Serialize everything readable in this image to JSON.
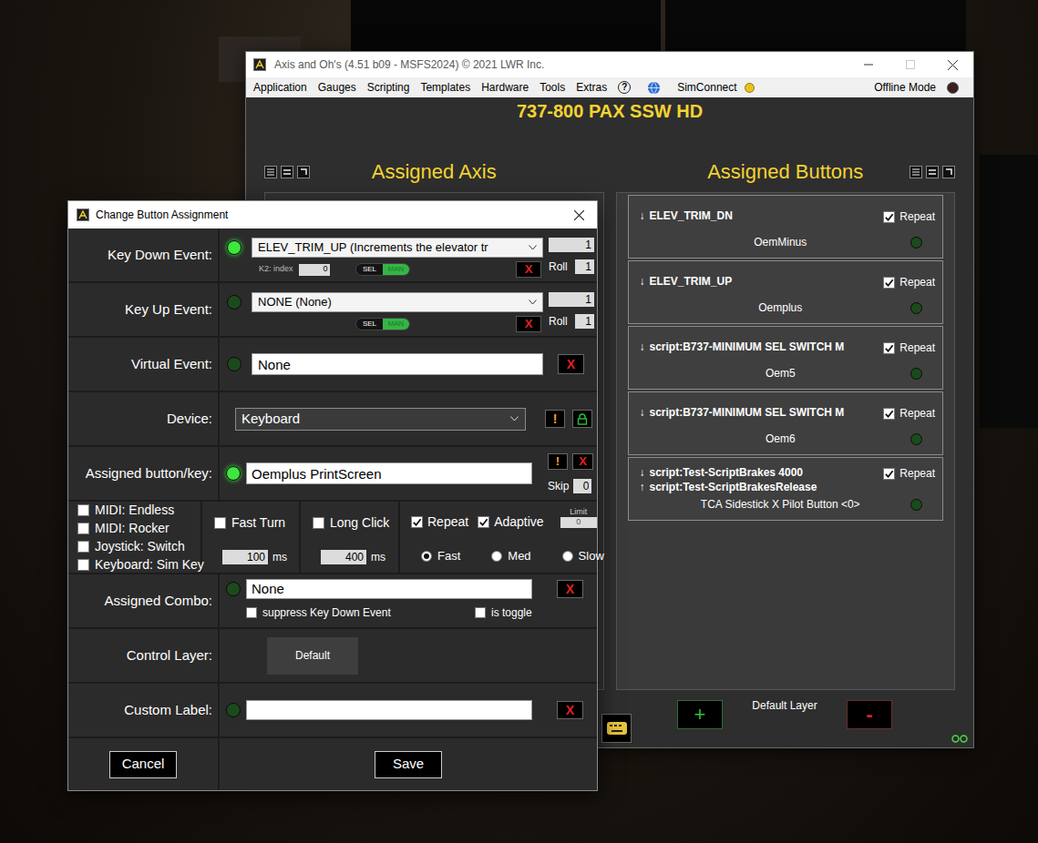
{
  "app": {
    "title": "Axis and Oh's (4.51 b09 - MSFS2024) © 2021 LWR Inc.",
    "menu": [
      "Application",
      "Gauges",
      "Scripting",
      "Templates",
      "Hardware",
      "Tools",
      "Extras"
    ],
    "help": "?",
    "simconnect": {
      "label": "SimConnect",
      "color": "#e8c21c"
    },
    "offline_mode": {
      "label": "Offline Mode",
      "color": "#3a2020"
    },
    "profile": "737-800 PAX SSW HD",
    "axis_title": "Assigned Axis",
    "buttons_title": "Assigned Buttons",
    "buttons": [
      {
        "events": [
          {
            "arrow": "↓",
            "text": "ELEV_TRIM_DN"
          }
        ],
        "repeat_label": "Repeat",
        "repeat": true,
        "key": "OemMinus",
        "active": false
      },
      {
        "events": [
          {
            "arrow": "↓",
            "text": "ELEV_TRIM_UP"
          }
        ],
        "repeat_label": "Repeat",
        "repeat": true,
        "key": "Oemplus",
        "active": false
      },
      {
        "events": [
          {
            "arrow": "↓",
            "text": "script:B737-MINIMUM SEL SWITCH M"
          }
        ],
        "repeat_label": "Repeat",
        "repeat": true,
        "key": "Oem5",
        "active": false
      },
      {
        "events": [
          {
            "arrow": "↓",
            "text": "script:B737-MINIMUM SEL SWITCH M"
          }
        ],
        "repeat_label": "Repeat",
        "repeat": true,
        "key": "Oem6",
        "active": false
      },
      {
        "events": [
          {
            "arrow": "↓",
            "text": "script:Test-ScriptBrakes 4000"
          },
          {
            "arrow": "↑",
            "text": "script:Test-ScriptBrakesRelease"
          }
        ],
        "repeat_label": "Repeat",
        "repeat": true,
        "key": "TCA Sidestick X Pilot Button <0>",
        "active": false
      }
    ],
    "layer": {
      "label": "Default Layer",
      "add": "+",
      "remove": "-"
    }
  },
  "dialog": {
    "title": "Change Button Assignment",
    "key_down": {
      "label": "Key Down Event:",
      "lit": true,
      "value": "ELEV_TRIM_UP (Increments the elevator tr",
      "k2_label": "K2: index",
      "k2_value": "0",
      "modes": [
        {
          "label": "SEL",
          "selected": false
        },
        {
          "label": "MAN",
          "selected": true
        }
      ],
      "clear": "X",
      "count": "1",
      "roll_label": "Roll",
      "roll": "1"
    },
    "key_up": {
      "label": "Key Up Event:",
      "lit": false,
      "value": "NONE (None)",
      "modes": [
        {
          "label": "SEL",
          "selected": false
        },
        {
          "label": "MAN",
          "selected": true
        }
      ],
      "clear": "X",
      "count": "1",
      "roll_label": "Roll",
      "roll": "1"
    },
    "virtual": {
      "label": "Virtual Event:",
      "lit": false,
      "value": "None",
      "clear": "X"
    },
    "device": {
      "label": "Device:",
      "value": "Keyboard",
      "warn": "!"
    },
    "assigned_key": {
      "label": "Assigned button/key:",
      "lit": true,
      "value": "Oemplus PrintScreen",
      "warn": "!",
      "clear": "X",
      "skip_label": "Skip",
      "skip": "0"
    },
    "flags": [
      {
        "label": "MIDI: Endless",
        "checked": false
      },
      {
        "label": "MIDI: Rocker",
        "checked": false
      },
      {
        "label": "Joystick: Switch",
        "checked": false
      },
      {
        "label": "Keyboard: Sim Key",
        "checked": false
      }
    ],
    "fast_turn": {
      "label": "Fast Turn",
      "checked": false,
      "value": "100",
      "unit": "ms"
    },
    "long_click": {
      "label": "Long Click",
      "checked": false,
      "value": "400",
      "unit": "ms"
    },
    "repeat": {
      "label": "Repeat",
      "checked": true
    },
    "adaptive": {
      "label": "Adaptive",
      "checked": true
    },
    "limit": {
      "label": "Limit",
      "value": "0"
    },
    "speeds": [
      {
        "label": "Fast",
        "selected": true
      },
      {
        "label": "Med",
        "selected": false
      },
      {
        "label": "Slow",
        "selected": false
      }
    ],
    "combo": {
      "label": "Assigned Combo:",
      "lit": false,
      "value": "None",
      "clear": "X",
      "options": [
        {
          "label": "suppress Key Down Event",
          "checked": false
        },
        {
          "label": "is toggle",
          "checked": false
        }
      ]
    },
    "control_layer": {
      "label": "Control Layer:",
      "value": "Default"
    },
    "custom_label": {
      "label": "Custom Label:",
      "lit": false,
      "value": "",
      "clear": "X"
    },
    "cancel": "Cancel",
    "save": "Save"
  }
}
